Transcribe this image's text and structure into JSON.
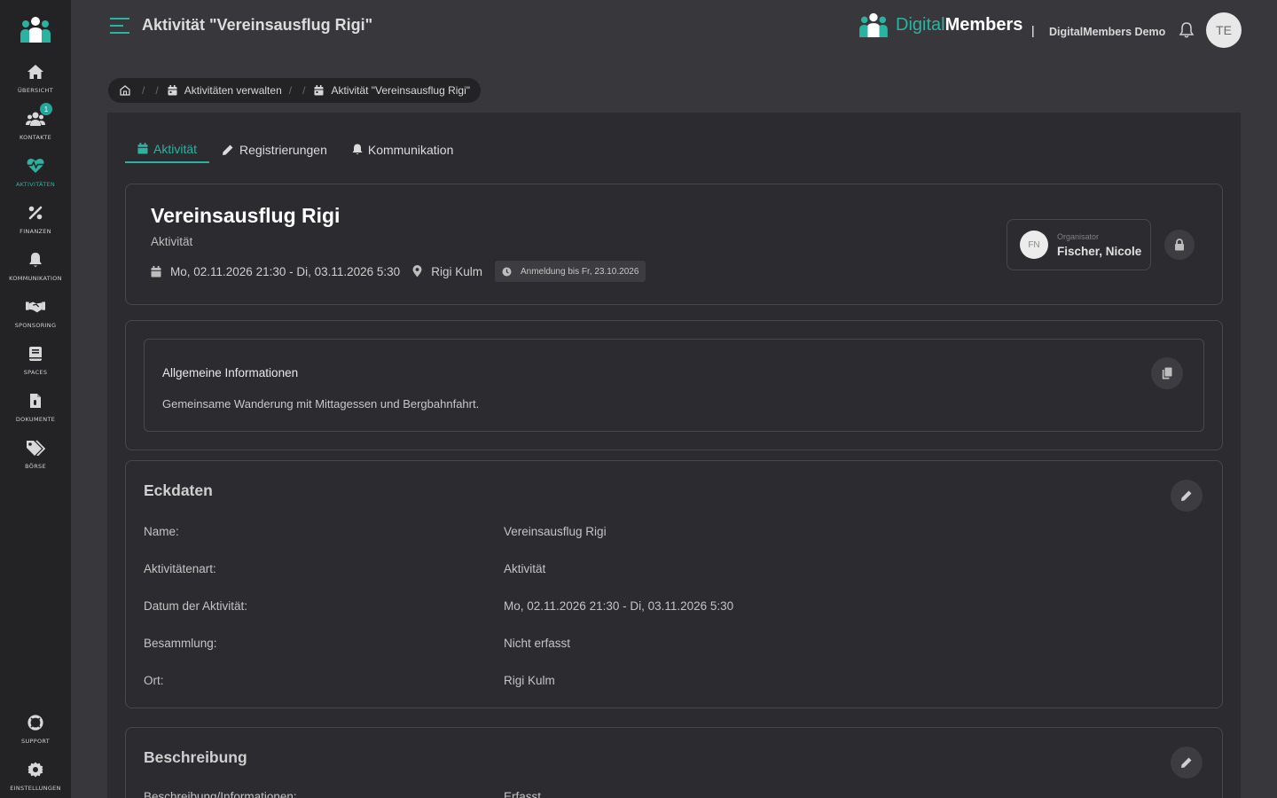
{
  "sidebar": {
    "items": [
      {
        "label": "Übersicht",
        "icon": "home-icon"
      },
      {
        "label": "Kontakte",
        "icon": "users-icon",
        "badge": "1"
      },
      {
        "label": "Aktivitäten",
        "icon": "heartbeat-icon"
      },
      {
        "label": "Finanzen",
        "icon": "percent-icon"
      },
      {
        "label": "Kommunikation",
        "icon": "bell-icon"
      },
      {
        "label": "Sponsoring",
        "icon": "handshake-icon"
      },
      {
        "label": "Spaces",
        "icon": "book-icon"
      },
      {
        "label": "Dokumente",
        "icon": "file-icon"
      },
      {
        "label": "Börse",
        "icon": "tags-icon"
      }
    ],
    "bottom": [
      {
        "label": "Support",
        "icon": "lifebuoy-icon"
      },
      {
        "label": "Einstellungen",
        "icon": "gear-icon"
      }
    ]
  },
  "header": {
    "title": "Aktivität \"Vereinsausflug Rigi\"",
    "brand_part1": "Digital",
    "brand_part2": "Members",
    "separator": "|",
    "org_name": "DigitalMembers Demo",
    "avatar_initials": "TE"
  },
  "breadcrumb": {
    "sep": "/",
    "items": [
      "Aktivitäten verwalten",
      "Aktivität \"Vereinsausflug Rigi\""
    ]
  },
  "tabs": [
    {
      "label": "Aktivität"
    },
    {
      "label": "Registrierungen"
    },
    {
      "label": "Kommunikation"
    }
  ],
  "event": {
    "title": "Vereinsausflug Rigi",
    "type": "Aktivität",
    "datetime": "Mo, 02.11.2026 21:30 - Di, 03.11.2026 5:30",
    "location": "Rigi Kulm",
    "registration": "Anmeldung bis Fr, 23.10.2026",
    "organizer_label": "Organisator",
    "organizer_name": "Fischer, Nicole",
    "organizer_initials": "FN"
  },
  "general_info": {
    "title": "Allgemeine Informationen",
    "text": "Gemeinsame Wanderung mit Mittagessen und Bergbahnfahrt."
  },
  "eckdaten": {
    "title": "Eckdaten",
    "rows": [
      {
        "key": "Name:",
        "value": "Vereinsausflug Rigi"
      },
      {
        "key": "Aktivitätenart:",
        "value": "Aktivität"
      },
      {
        "key": "Datum der Aktivität:",
        "value": "Mo, 02.11.2026 21:30 - Di, 03.11.2026 5:30"
      },
      {
        "key": "Besammlung:",
        "value": "Nicht erfasst"
      },
      {
        "key": "Ort:",
        "value": "Rigi Kulm"
      }
    ]
  },
  "beschreibung": {
    "title": "Beschreibung",
    "rows": [
      {
        "key": "Beschreibung/Informationen:",
        "value": "Erfasst"
      }
    ]
  },
  "colors": {
    "accent": "#2ab3a0",
    "background": "#38383c",
    "sidebar": "#232326",
    "panel": "#2c2c30"
  }
}
